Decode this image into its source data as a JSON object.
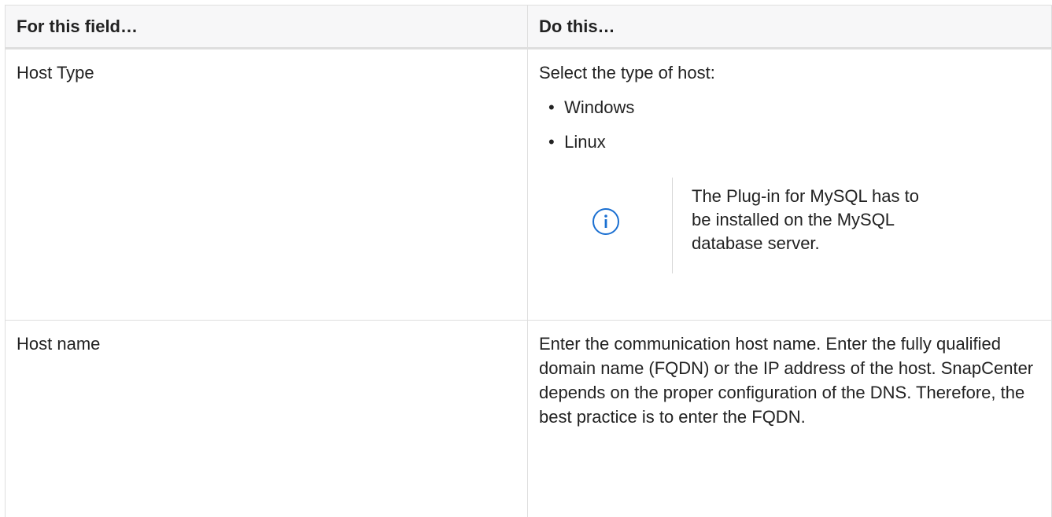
{
  "table": {
    "headers": [
      "For this field…",
      "Do this…"
    ],
    "rows": [
      {
        "field": "Host Type",
        "intro": "Select the type of host:",
        "options": [
          "Windows",
          "Linux"
        ],
        "bullet_glyph": "•",
        "note": {
          "icon": "info-icon",
          "text": "The Plug-in for MySQL has to be installed on the MySQL database server."
        }
      },
      {
        "field": "Host name",
        "description": "Enter the communication host name. Enter the fully qualified domain name (FQDN) or the IP address of the host. SnapCenter depends on the proper configuration of the DNS. Therefore, the best practice is to enter the FQDN."
      }
    ]
  },
  "colors": {
    "info_icon": "#1a6fd1",
    "header_bg": "#f7f7f8",
    "border": "#dedede"
  }
}
